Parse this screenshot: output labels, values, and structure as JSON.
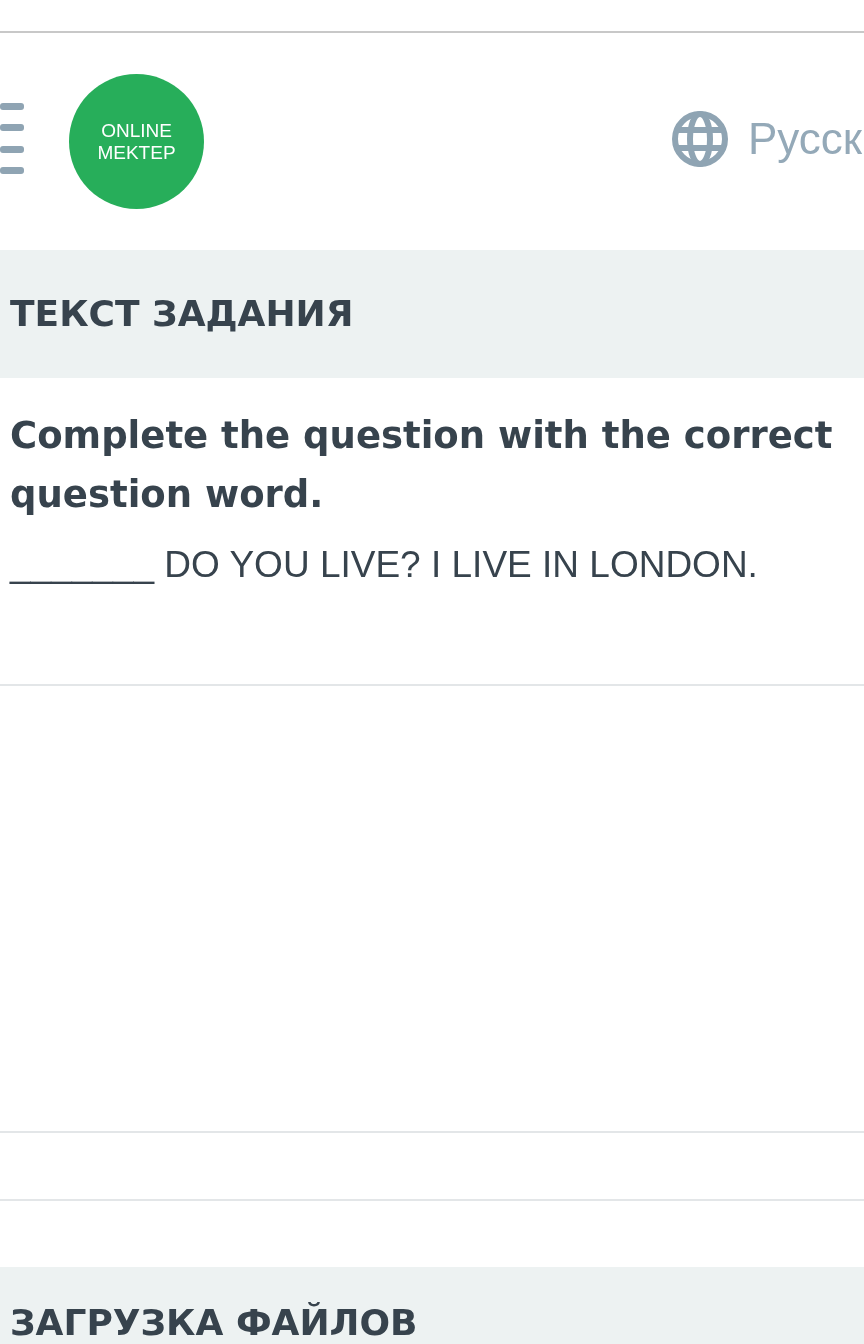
{
  "header": {
    "logo": [
      "ONLINE",
      "MEKTEP"
    ],
    "language": "Русск"
  },
  "task_section": {
    "title": "ТЕКСТ ЗАДАНИЯ",
    "instruction": "Complete the question with the correct question word.",
    "question": "_______ DO YOU LIVE? I LIVE IN LONDON."
  },
  "upload_section": {
    "title": "ЗАГРУЗКА ФАЙЛОВ"
  }
}
